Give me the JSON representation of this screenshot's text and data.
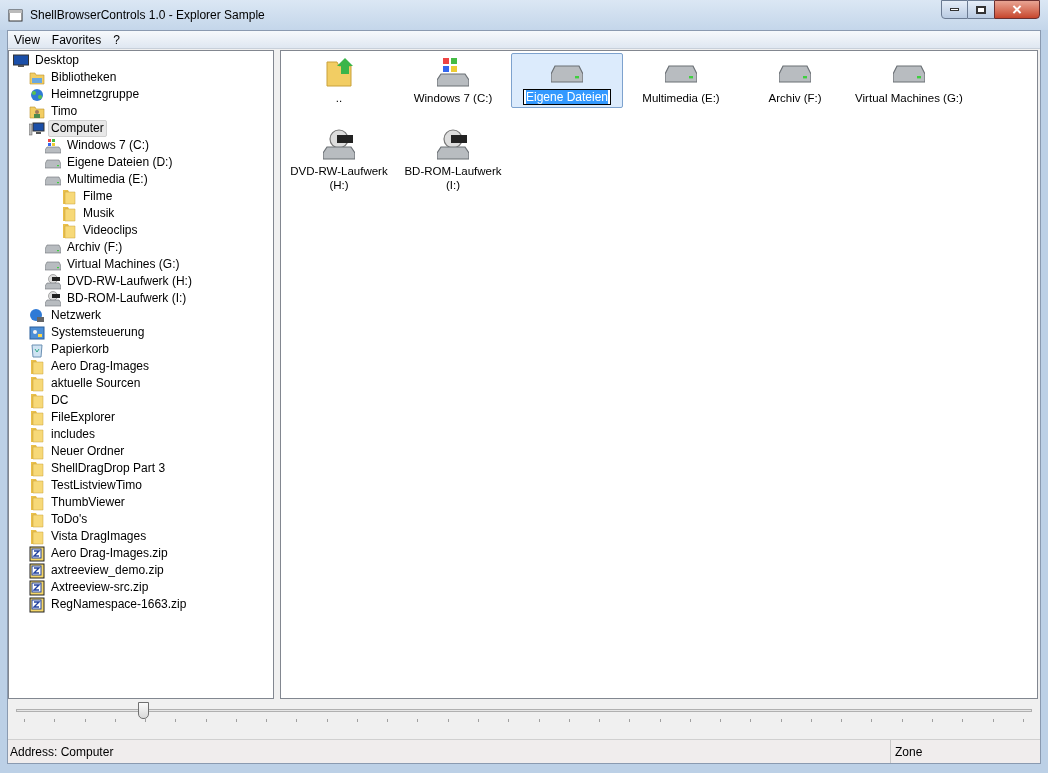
{
  "window": {
    "title": "ShellBrowserControls 1.0 - Explorer Sample"
  },
  "menu": [
    "View",
    "Favorites",
    "?"
  ],
  "tree": [
    {
      "label": "Desktop",
      "kind": "desktop",
      "selected": false,
      "children": [
        {
          "label": "Bibliotheken",
          "kind": "library",
          "selected": false
        },
        {
          "label": "Heimnetzgruppe",
          "kind": "homegroup",
          "selected": false
        },
        {
          "label": "Timo",
          "kind": "user",
          "selected": false
        },
        {
          "label": "Computer",
          "kind": "computer",
          "selected": true,
          "children": [
            {
              "label": "Windows 7 (C:)",
              "kind": "windrive",
              "selected": false
            },
            {
              "label": "Eigene Dateien (D:)",
              "kind": "drive",
              "selected": false
            },
            {
              "label": "Multimedia (E:)",
              "kind": "drive",
              "selected": false,
              "children": [
                {
                  "label": "Filme",
                  "kind": "folder",
                  "selected": false
                },
                {
                  "label": "Musik",
                  "kind": "folder",
                  "selected": false
                },
                {
                  "label": "Videoclips",
                  "kind": "folder",
                  "selected": false
                }
              ]
            },
            {
              "label": "Archiv (F:)",
              "kind": "drive",
              "selected": false
            },
            {
              "label": "Virtual Machines (G:)",
              "kind": "drive",
              "selected": false
            },
            {
              "label": "DVD-RW-Laufwerk (H:)",
              "kind": "optical",
              "selected": false
            },
            {
              "label": "BD-ROM-Laufwerk (I:)",
              "kind": "optical",
              "selected": false
            }
          ]
        },
        {
          "label": "Netzwerk",
          "kind": "network",
          "selected": false
        },
        {
          "label": "Systemsteuerung",
          "kind": "controlpanel",
          "selected": false
        },
        {
          "label": "Papierkorb",
          "kind": "recycle",
          "selected": false
        },
        {
          "label": "Aero Drag-Images",
          "kind": "folder",
          "selected": false
        },
        {
          "label": "aktuelle Sourcen",
          "kind": "folder",
          "selected": false
        },
        {
          "label": "DC",
          "kind": "folder",
          "selected": false
        },
        {
          "label": "FileExplorer",
          "kind": "folder",
          "selected": false
        },
        {
          "label": "includes",
          "kind": "folder",
          "selected": false
        },
        {
          "label": "Neuer Ordner",
          "kind": "folder",
          "selected": false
        },
        {
          "label": "ShellDragDrop Part 3",
          "kind": "folder",
          "selected": false
        },
        {
          "label": "TestListviewTimo",
          "kind": "folder",
          "selected": false
        },
        {
          "label": "ThumbViewer",
          "kind": "folder",
          "selected": false
        },
        {
          "label": "ToDo's",
          "kind": "folder",
          "selected": false
        },
        {
          "label": "Vista DragImages",
          "kind": "folder",
          "selected": false
        },
        {
          "label": "Aero Drag-Images.zip",
          "kind": "zip",
          "selected": false
        },
        {
          "label": "axtreeview_demo.zip",
          "kind": "zip",
          "selected": false
        },
        {
          "label": "Axtreeview-src.zip",
          "kind": "zip",
          "selected": false
        },
        {
          "label": "RegNamespace-1663.zip",
          "kind": "zip",
          "selected": false
        }
      ]
    }
  ],
  "items": [
    {
      "label": "..",
      "kind": "up",
      "selected": false
    },
    {
      "label": "Windows 7 (C:)",
      "kind": "windrive",
      "selected": false
    },
    {
      "label": "Eigene Dateien",
      "kind": "drive",
      "selected": true
    },
    {
      "label": "Multimedia (E:)",
      "kind": "drive",
      "selected": false
    },
    {
      "label": "Archiv (F:)",
      "kind": "drive",
      "selected": false
    },
    {
      "label": "Virtual Machines (G:)",
      "kind": "drive",
      "selected": false
    },
    {
      "label": "DVD-RW-Laufwerk (H:)",
      "kind": "dvd",
      "selected": false
    },
    {
      "label": "BD-ROM-Laufwerk (I:)",
      "kind": "bd",
      "selected": false
    }
  ],
  "zoom_slider": {
    "level": 0.125
  },
  "status_bar": {
    "address": "Address: Computer",
    "zone": "Zone"
  }
}
